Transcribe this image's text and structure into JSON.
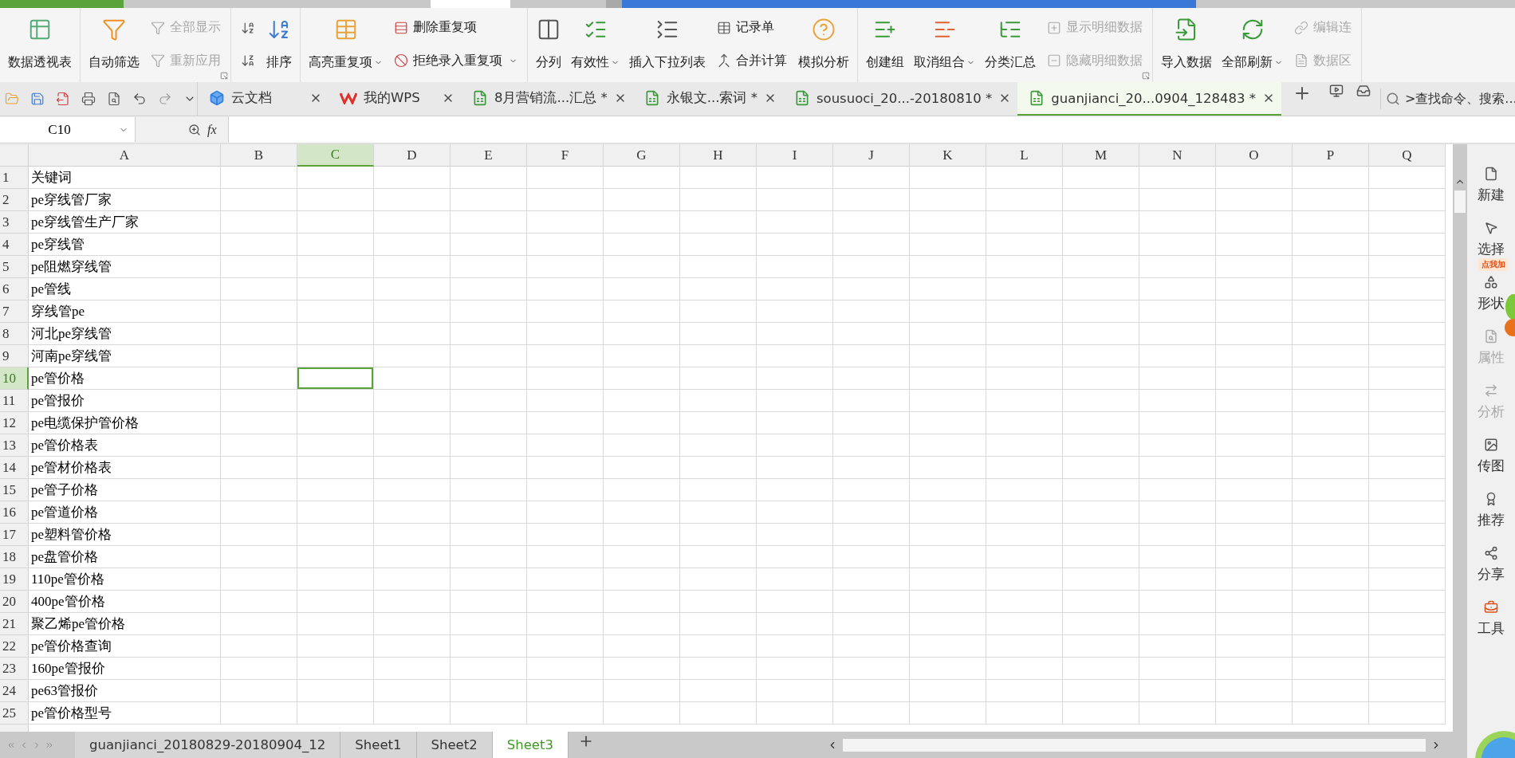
{
  "ribbon": {
    "groups": [
      {
        "launcher": false,
        "columns": [
          {
            "kind": "large",
            "buttons": [
              {
                "label": "数据透视表",
                "dropdown": false,
                "disabled": false
              }
            ]
          }
        ]
      },
      {
        "launcher": true,
        "columns": [
          {
            "kind": "large",
            "buttons": [
              {
                "label": "自动筛选",
                "dropdown": false,
                "disabled": false
              }
            ]
          },
          {
            "kind": "stack",
            "buttons": [
              {
                "label": "全部显示",
                "dropdown": false,
                "disabled": true
              },
              {
                "label": "重新应用",
                "dropdown": false,
                "disabled": true
              }
            ]
          }
        ]
      },
      {
        "launcher": false,
        "columns": [
          {
            "kind": "stack",
            "buttons": [
              {
                "dropdown": false,
                "disabled": false
              },
              {
                "dropdown": false,
                "disabled": false
              }
            ]
          },
          {
            "kind": "large",
            "buttons": [
              {
                "label": "排序",
                "dropdown": false,
                "disabled": false
              }
            ]
          }
        ]
      },
      {
        "launcher": false,
        "columns": [
          {
            "kind": "large",
            "buttons": [
              {
                "label": "高亮重复项",
                "dropdown": true,
                "disabled": false
              }
            ]
          },
          {
            "kind": "stack",
            "buttons": [
              {
                "label": "删除重复项",
                "dropdown": false,
                "disabled": false
              },
              {
                "label": "拒绝录入重复项",
                "dropdown": true,
                "disabled": false
              }
            ]
          }
        ]
      },
      {
        "launcher": false,
        "columns": [
          {
            "kind": "large",
            "buttons": [
              {
                "label": "分列",
                "dropdown": false,
                "disabled": false
              }
            ]
          },
          {
            "kind": "large",
            "buttons": [
              {
                "label": "有效性",
                "dropdown": true,
                "disabled": false
              }
            ]
          },
          {
            "kind": "large",
            "buttons": [
              {
                "label": "插入下拉列表",
                "dropdown": false,
                "disabled": false
              }
            ]
          },
          {
            "kind": "stack",
            "buttons": [
              {
                "label": "记录单",
                "dropdown": false,
                "disabled": false
              },
              {
                "label": "合并计算",
                "dropdown": false,
                "disabled": false
              }
            ]
          },
          {
            "kind": "large",
            "buttons": [
              {
                "label": "模拟分析",
                "dropdown": false,
                "disabled": false
              }
            ]
          }
        ]
      },
      {
        "launcher": true,
        "columns": [
          {
            "kind": "large",
            "buttons": [
              {
                "label": "创建组",
                "dropdown": false,
                "disabled": false
              }
            ]
          },
          {
            "kind": "large",
            "buttons": [
              {
                "label": "取消组合",
                "dropdown": true,
                "disabled": false
              }
            ]
          },
          {
            "kind": "large",
            "buttons": [
              {
                "label": "分类汇总",
                "dropdown": false,
                "disabled": false
              }
            ]
          },
          {
            "kind": "stack",
            "buttons": [
              {
                "label": "显示明细数据",
                "dropdown": false,
                "disabled": true
              },
              {
                "label": "隐藏明细数据",
                "dropdown": false,
                "disabled": true
              }
            ]
          }
        ]
      },
      {
        "launcher": false,
        "columns": [
          {
            "kind": "large",
            "buttons": [
              {
                "label": "导入数据",
                "dropdown": false,
                "disabled": false
              }
            ]
          },
          {
            "kind": "large",
            "buttons": [
              {
                "label": "全部刷新",
                "dropdown": true,
                "disabled": false
              }
            ]
          },
          {
            "kind": "stack",
            "buttons": [
              {
                "label": "编辑连",
                "dropdown": false,
                "disabled": true
              },
              {
                "label": "数据区",
                "dropdown": false,
                "disabled": true
              }
            ]
          }
        ]
      }
    ]
  },
  "doc_tabs": [
    {
      "kind": "cloud",
      "label": "云文档",
      "selected": false
    },
    {
      "kind": "wps",
      "label": "我的WPS",
      "selected": false
    },
    {
      "kind": "sheet",
      "label": "8月营销流...汇总 *",
      "selected": false
    },
    {
      "kind": "sheet",
      "label": "永银文...索词 *",
      "selected": false
    },
    {
      "kind": "sheet",
      "label": "sousuoci_20...-20180810 *",
      "selected": false
    },
    {
      "kind": "sheet",
      "label": "guanjianci_20...0904_128483 *",
      "selected": true
    }
  ],
  "search": {
    "placeholder": ">查找命令、搜索..."
  },
  "formula_bar": {
    "name_box": "C10",
    "fx": "fx"
  },
  "columns": [
    {
      "label": "A",
      "selected": false
    },
    {
      "label": "B",
      "selected": false
    },
    {
      "label": "C",
      "selected": true
    },
    {
      "label": "D",
      "selected": false
    },
    {
      "label": "E",
      "selected": false
    },
    {
      "label": "F",
      "selected": false
    },
    {
      "label": "G",
      "selected": false
    },
    {
      "label": "H",
      "selected": false
    },
    {
      "label": "I",
      "selected": false
    },
    {
      "label": "J",
      "selected": false
    },
    {
      "label": "K",
      "selected": false
    },
    {
      "label": "L",
      "selected": false
    },
    {
      "label": "M",
      "selected": false
    },
    {
      "label": "N",
      "selected": false
    },
    {
      "label": "O",
      "selected": false
    },
    {
      "label": "P",
      "selected": false
    },
    {
      "label": "Q",
      "selected": false
    }
  ],
  "rows": [
    {
      "number": "1",
      "a": "关键词",
      "selected": false
    },
    {
      "number": "2",
      "a": "pe穿线管厂家",
      "selected": false
    },
    {
      "number": "3",
      "a": "pe穿线管生产厂家",
      "selected": false
    },
    {
      "number": "4",
      "a": "pe穿线管",
      "selected": false
    },
    {
      "number": "5",
      "a": "pe阻燃穿线管",
      "selected": false
    },
    {
      "number": "6",
      "a": "pe管线",
      "selected": false
    },
    {
      "number": "7",
      "a": "穿线管pe",
      "selected": false
    },
    {
      "number": "8",
      "a": "河北pe穿线管",
      "selected": false
    },
    {
      "number": "9",
      "a": "河南pe穿线管",
      "selected": false
    },
    {
      "number": "10",
      "a": "pe管价格",
      "selected": true
    },
    {
      "number": "11",
      "a": "pe管报价",
      "selected": false
    },
    {
      "number": "12",
      "a": "pe电缆保护管价格",
      "selected": false
    },
    {
      "number": "13",
      "a": "pe管价格表",
      "selected": false
    },
    {
      "number": "14",
      "a": "pe管材价格表",
      "selected": false
    },
    {
      "number": "15",
      "a": "pe管子价格",
      "selected": false
    },
    {
      "number": "16",
      "a": "pe管道价格",
      "selected": false
    },
    {
      "number": "17",
      "a": "pe塑料管价格",
      "selected": false
    },
    {
      "number": "18",
      "a": "pe盘管价格",
      "selected": false
    },
    {
      "number": "19",
      "a": "110pe管价格",
      "selected": false
    },
    {
      "number": "20",
      "a": "400pe管价格",
      "selected": false
    },
    {
      "number": "21",
      "a": "聚乙烯pe管价格",
      "selected": false
    },
    {
      "number": "22",
      "a": "pe管价格查询",
      "selected": false
    },
    {
      "number": "23",
      "a": "160pe管报价",
      "selected": false
    },
    {
      "number": "24",
      "a": "pe63管报价",
      "selected": false
    },
    {
      "number": "25",
      "a": "pe管价格型号",
      "selected": false
    }
  ],
  "sheet_tabs": [
    {
      "label": "guanjianci_20180829-20180904_12",
      "selected": false
    },
    {
      "label": "Sheet1",
      "selected": false
    },
    {
      "label": "Sheet2",
      "selected": false
    },
    {
      "label": "Sheet3",
      "selected": true
    }
  ],
  "sidebar": {
    "items": [
      {
        "label": "新建",
        "disabled": false
      },
      {
        "label": "选择",
        "disabled": false
      },
      {
        "label": "形状",
        "disabled": false
      },
      {
        "label": "属性",
        "disabled": true
      },
      {
        "label": "分析",
        "disabled": true
      },
      {
        "label": "传图",
        "disabled": false
      },
      {
        "label": "推荐",
        "disabled": false
      },
      {
        "label": "分享",
        "disabled": false
      },
      {
        "label": "工具",
        "disabled": false
      }
    ]
  },
  "mascot": {
    "tag": "点我加"
  }
}
